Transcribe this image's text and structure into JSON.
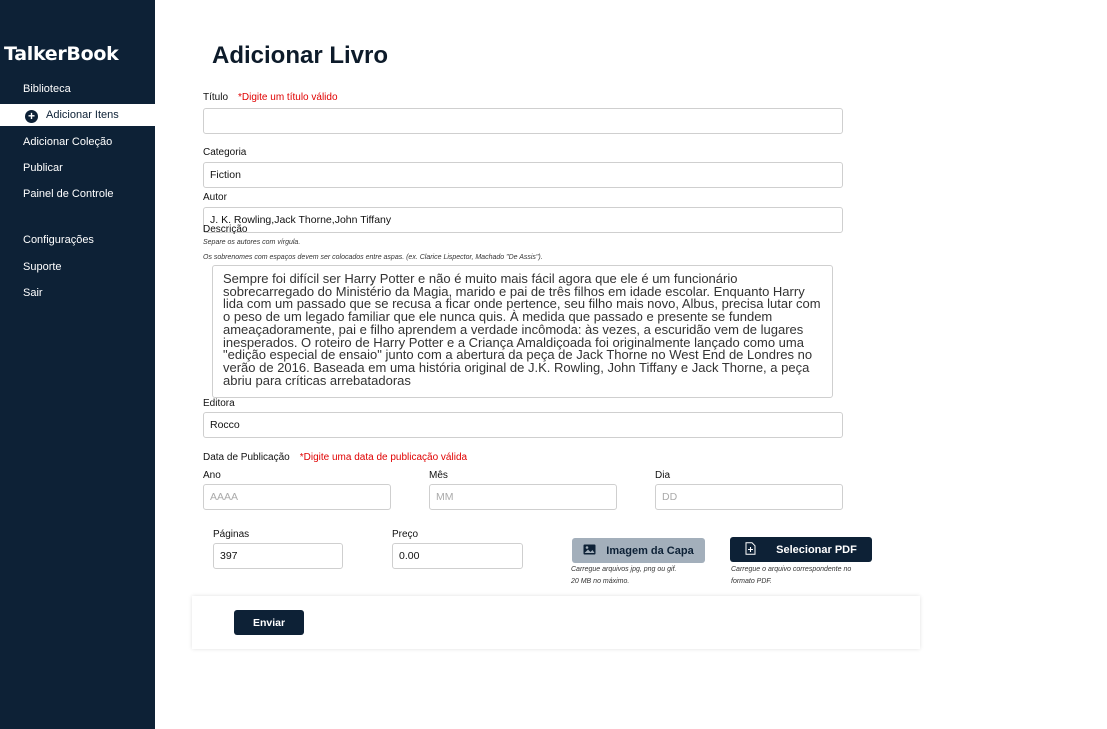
{
  "app": {
    "name": "TalkerBook"
  },
  "sidebar": {
    "items": [
      {
        "label": "Biblioteca"
      },
      {
        "label": "Adicionar Itens",
        "active": true
      },
      {
        "label": "Adicionar Coleção"
      },
      {
        "label": "Publicar"
      },
      {
        "label": "Painel de Controle"
      },
      {
        "label": "Configurações"
      },
      {
        "label": "Suporte"
      },
      {
        "label": "Sair"
      }
    ]
  },
  "page": {
    "title": "Adicionar Livro"
  },
  "form": {
    "title": {
      "label": "Título",
      "error": "*Digite um título válido",
      "value": ""
    },
    "category": {
      "label": "Categoria",
      "value": "Fiction"
    },
    "author": {
      "label": "Autor",
      "value": "J. K. Rowling,Jack Thorne,John Tiffany",
      "hint1": "Separe os autores com vírgula.",
      "hint2": "Os sobrenomes com espaços devem ser colocados entre aspas. (ex. Clarice Lispector, Machado \"De Assis\")."
    },
    "description": {
      "label": "Descrição",
      "value": "Sempre foi difícil ser Harry Potter e não é muito mais fácil agora que ele é um funcionário sobrecarregado do Ministério da Magia, marido e pai de três filhos em idade escolar. Enquanto Harry lida com um passado que se recusa a ficar onde pertence, seu filho mais novo, Albus, precisa lutar com o peso de um legado familiar que ele nunca quis. À medida que passado e presente se fundem ameaçadoramente, pai e filho aprendem a verdade incômoda: às vezes, a escuridão vem de lugares inesperados. O roteiro de Harry Potter e a Criança Amaldiçoada foi originalmente lançado como uma \"edição especial de ensaio\" junto com a abertura da peça de Jack Thorne no West End de Londres no verão de 2016. Baseada em uma história original de J.K. Rowling, John Tiffany e Jack Thorne, a peça abriu para críticas arrebatadoras"
    },
    "publisher": {
      "label": "Editora",
      "value": "Rocco"
    },
    "pub_date": {
      "label": "Data de Publicação",
      "error": "*Digite uma data de publicação válida",
      "year": {
        "label": "Ano",
        "placeholder": "AAAA"
      },
      "month": {
        "label": "Mês",
        "placeholder": "MM"
      },
      "day": {
        "label": "Dia",
        "placeholder": "DD"
      }
    },
    "pages": {
      "label": "Páginas",
      "value": "397"
    },
    "price": {
      "label": "Preço",
      "value": "0.00"
    },
    "cover": {
      "button": "Imagem da Capa",
      "icon": "image-icon",
      "hint1": "Carregue arquivos jpg, png ou gif.",
      "hint2": "20 MB no máximo."
    },
    "pdf": {
      "button": "Selecionar PDF",
      "icon": "file-add-icon",
      "hint1": "Carregue o arquivo correspondente no",
      "hint2": "formato PDF."
    },
    "submit": "Enviar"
  },
  "colors": {
    "sidebar": "#0d2136",
    "error": "#e00000",
    "disabled_button": "#a3afbb"
  }
}
